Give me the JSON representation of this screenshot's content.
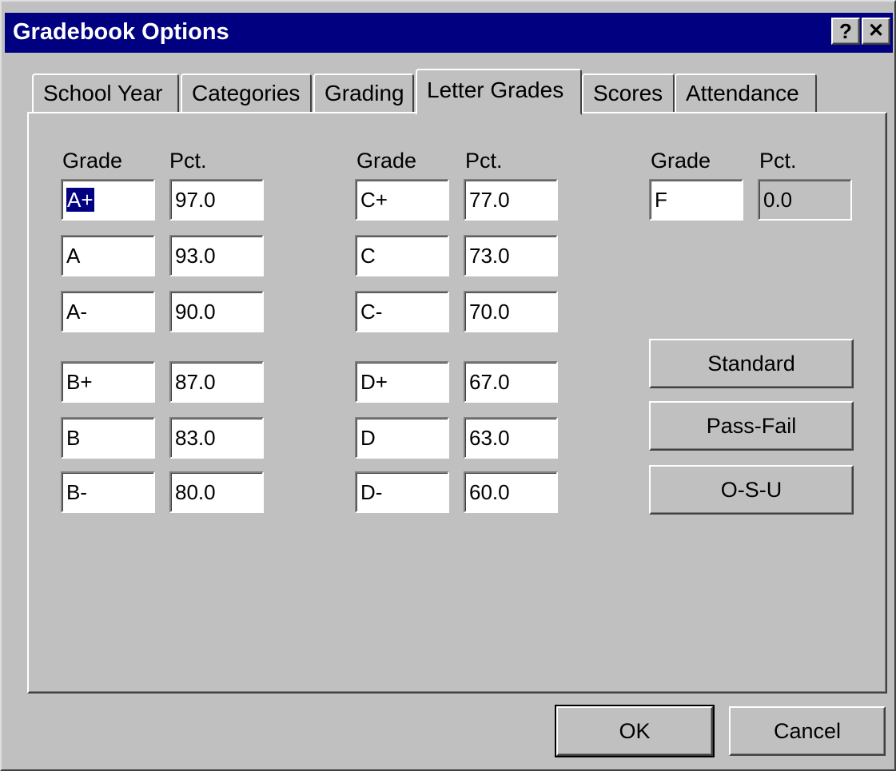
{
  "window": {
    "title": "Gradebook Options",
    "help_button": "?",
    "close_button": "✕"
  },
  "tabs": [
    {
      "label": "School Year",
      "active": false
    },
    {
      "label": "Categories",
      "active": false
    },
    {
      "label": "Grading",
      "active": false
    },
    {
      "label": "Letter Grades",
      "active": true
    },
    {
      "label": "Scores",
      "active": false
    },
    {
      "label": "Attendance",
      "active": false
    }
  ],
  "letter_grades": {
    "grade_header": "Grade",
    "pct_header": "Pct.",
    "column1": [
      {
        "grade": "A+",
        "pct": "97.0"
      },
      {
        "grade": "A",
        "pct": "93.0"
      },
      {
        "grade": "A-",
        "pct": "90.0"
      },
      {
        "grade": "B+",
        "pct": "87.0"
      },
      {
        "grade": "B",
        "pct": "83.0"
      },
      {
        "grade": "B-",
        "pct": "80.0"
      }
    ],
    "column2": [
      {
        "grade": "C+",
        "pct": "77.0"
      },
      {
        "grade": "C",
        "pct": "73.0"
      },
      {
        "grade": "C-",
        "pct": "70.0"
      },
      {
        "grade": "D+",
        "pct": "67.0"
      },
      {
        "grade": "D",
        "pct": "63.0"
      },
      {
        "grade": "D-",
        "pct": "60.0"
      }
    ],
    "column3": [
      {
        "grade": "F",
        "pct": "0.0"
      }
    ]
  },
  "preset_buttons": {
    "standard": "Standard",
    "pass_fail": "Pass-Fail",
    "osu": "O-S-U"
  },
  "footer": {
    "ok": "OK",
    "cancel": "Cancel"
  },
  "colors": {
    "titlebar": "#000080",
    "face": "#c0c0c0",
    "selection": "#000080"
  }
}
